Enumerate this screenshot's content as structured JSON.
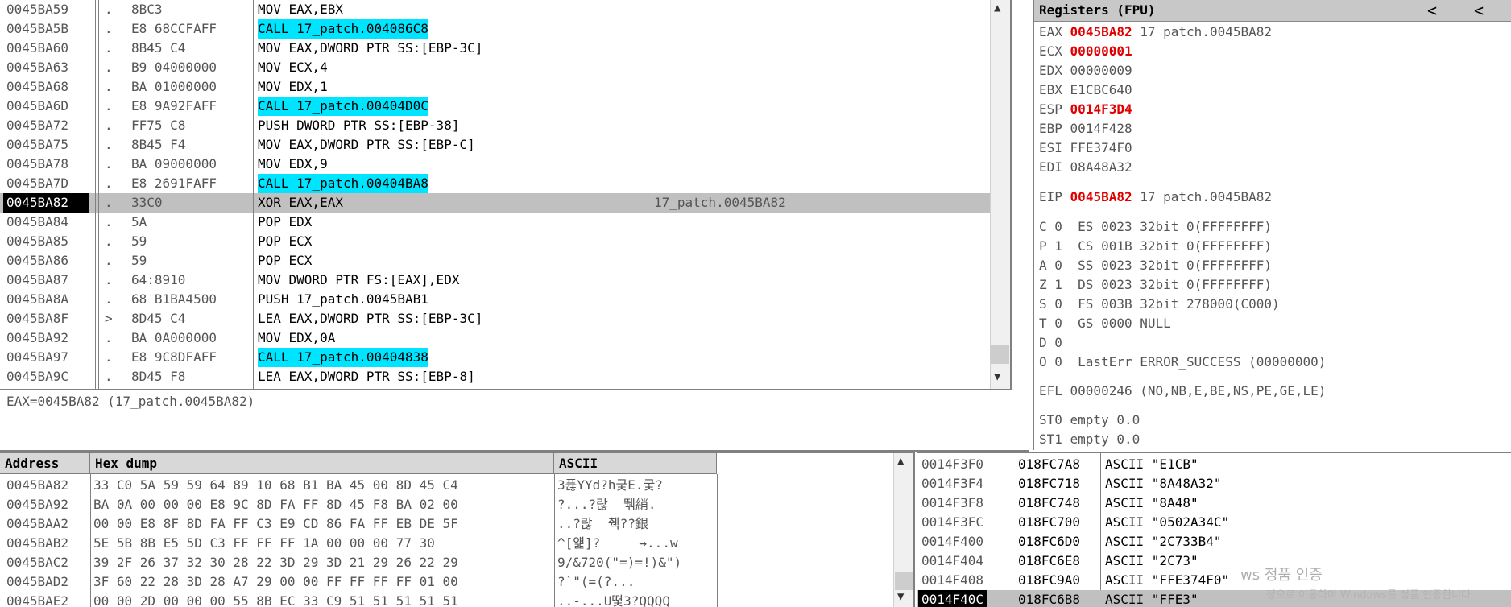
{
  "disasm": {
    "rows": [
      {
        "addr": "0045BA59",
        "mark": ".",
        "hex": "8BC3",
        "asm": "MOV EAX,EBX",
        "call": false,
        "comment": ""
      },
      {
        "addr": "0045BA5B",
        "mark": ".",
        "hex": "E8 68CCFAFF",
        "asm": "CALL 17_patch.004086C8",
        "call": true,
        "comment": ""
      },
      {
        "addr": "0045BA60",
        "mark": ".",
        "hex": "8B45 C4",
        "asm": "MOV EAX,DWORD PTR SS:[EBP-3C]",
        "call": false,
        "comment": ""
      },
      {
        "addr": "0045BA63",
        "mark": ".",
        "hex": "B9 04000000",
        "asm": "MOV ECX,4",
        "call": false,
        "comment": ""
      },
      {
        "addr": "0045BA68",
        "mark": ".",
        "hex": "BA 01000000",
        "asm": "MOV EDX,1",
        "call": false,
        "comment": ""
      },
      {
        "addr": "0045BA6D",
        "mark": ".",
        "hex": "E8 9A92FAFF",
        "asm": "CALL 17_patch.00404D0C",
        "call": true,
        "comment": ""
      },
      {
        "addr": "0045BA72",
        "mark": ".",
        "hex": "FF75 C8",
        "asm": "PUSH DWORD PTR SS:[EBP-38]",
        "call": false,
        "comment": ""
      },
      {
        "addr": "0045BA75",
        "mark": ".",
        "hex": "8B45 F4",
        "asm": "MOV EAX,DWORD PTR SS:[EBP-C]",
        "call": false,
        "comment": ""
      },
      {
        "addr": "0045BA78",
        "mark": ".",
        "hex": "BA 09000000",
        "asm": "MOV EDX,9",
        "call": false,
        "comment": ""
      },
      {
        "addr": "0045BA7D",
        "mark": ".",
        "hex": "E8 2691FAFF",
        "asm": "CALL 17_patch.00404BA8",
        "call": true,
        "comment": ""
      },
      {
        "addr": "0045BA82",
        "mark": ".",
        "hex": "33C0",
        "asm": "XOR EAX,EAX",
        "call": false,
        "comment": "17_patch.0045BA82",
        "selected": true
      },
      {
        "addr": "0045BA84",
        "mark": ".",
        "hex": "5A",
        "asm": "POP EDX",
        "call": false,
        "comment": ""
      },
      {
        "addr": "0045BA85",
        "mark": ".",
        "hex": "59",
        "asm": "POP ECX",
        "call": false,
        "comment": ""
      },
      {
        "addr": "0045BA86",
        "mark": ".",
        "hex": "59",
        "asm": "POP ECX",
        "call": false,
        "comment": ""
      },
      {
        "addr": "0045BA87",
        "mark": ".",
        "hex": "64:8910",
        "asm": "MOV DWORD PTR FS:[EAX],EDX",
        "call": false,
        "comment": ""
      },
      {
        "addr": "0045BA8A",
        "mark": ".",
        "hex": "68 B1BA4500",
        "asm": "PUSH 17_patch.0045BAB1",
        "call": false,
        "comment": ""
      },
      {
        "addr": "0045BA8F",
        "mark": ">",
        "hex": "8D45 C4",
        "asm": "LEA EAX,DWORD PTR SS:[EBP-3C]",
        "call": false,
        "comment": ""
      },
      {
        "addr": "0045BA92",
        "mark": ".",
        "hex": "BA 0A000000",
        "asm": "MOV EDX,0A",
        "call": false,
        "comment": ""
      },
      {
        "addr": "0045BA97",
        "mark": ".",
        "hex": "E8 9C8DFAFF",
        "asm": "CALL 17_patch.00404838",
        "call": true,
        "comment": ""
      },
      {
        "addr": "0045BA9C",
        "mark": ".",
        "hex": "8D45 F8",
        "asm": "LEA EAX,DWORD PTR SS:[EBP-8]",
        "call": false,
        "comment": ""
      }
    ]
  },
  "info": {
    "text": "EAX=0045BA82 (17_patch.0045BA82)"
  },
  "registers": {
    "title": "Registers (FPU)",
    "nav_left": "<",
    "nav_right": "<",
    "general": [
      {
        "name": "EAX",
        "value": "0045BA82",
        "changed": true,
        "comment": "17_patch.0045BA82"
      },
      {
        "name": "ECX",
        "value": "00000001",
        "changed": true,
        "comment": ""
      },
      {
        "name": "EDX",
        "value": "00000009",
        "changed": false,
        "comment": ""
      },
      {
        "name": "EBX",
        "value": "E1CBC640",
        "changed": false,
        "comment": ""
      },
      {
        "name": "ESP",
        "value": "0014F3D4",
        "changed": true,
        "comment": ""
      },
      {
        "name": "EBP",
        "value": "0014F428",
        "changed": false,
        "comment": ""
      },
      {
        "name": "ESI",
        "value": "FFE374F0",
        "changed": false,
        "comment": ""
      },
      {
        "name": "EDI",
        "value": "08A48A32",
        "changed": false,
        "comment": ""
      }
    ],
    "eip": {
      "name": "EIP",
      "value": "0045BA82",
      "changed": true,
      "comment": "17_patch.0045BA82"
    },
    "flags": [
      "C 0  ES 0023 32bit 0(FFFFFFFF)",
      "P 1  CS 001B 32bit 0(FFFFFFFF)",
      "A 0  SS 0023 32bit 0(FFFFFFFF)",
      "Z 1  DS 0023 32bit 0(FFFFFFFF)",
      "S 0  FS 003B 32bit 278000(C000)",
      "T 0  GS 0000 NULL",
      "D 0",
      "O 0  LastErr ERROR_SUCCESS (00000000)"
    ],
    "efl": "EFL 00000246 (NO,NB,E,BE,NS,PE,GE,LE)",
    "fpu": [
      "ST0 empty 0.0",
      "ST1 empty 0.0"
    ]
  },
  "hexdump": {
    "col_address": "Address",
    "col_hex": "Hex dump",
    "col_ascii": "ASCII",
    "rows": [
      {
        "addr": "0045BA82",
        "bytes": "33 C0 5A 59 59 64 89 10 68 B1 BA 45 00 8D 45 C4",
        "ascii": "3퓮YYd?h긏E.궃?"
      },
      {
        "addr": "0045BA92",
        "bytes": "BA 0A 00 00 00 E8 9C 8D FA FF 8D 45 F8 BA 02 00",
        "ascii": "?...?랂  뛖綃."
      },
      {
        "addr": "0045BAA2",
        "bytes": "00 00 E8 8F 8D FA FF C3 E9 CD 86 FA FF EB DE 5F",
        "ascii": "..?랂  췍??銀_"
      },
      {
        "addr": "0045BAB2",
        "bytes": "5E 5B 8B E5 5D C3 FF FF FF 1A 00 00 00 77 30",
        "ascii": "^[얥]?     →...w"
      },
      {
        "addr": "0045BAC2",
        "bytes": "39 2F 26 37 32 30 28 22 3D 29 3D 21 29 26 22 29",
        "ascii": "9/&720(\"=)=!)&\")"
      },
      {
        "addr": "0045BAD2",
        "bytes": "3F 60 22 28 3D 28 A7 29 00 00 FF FF FF FF 01 00",
        "ascii": "?`\"(=(?..."
      },
      {
        "addr": "0045BAE2",
        "bytes": "00 00 2D 00 00 00 55 8B EC 33 C9 51 51 51 51 51",
        "ascii": "..-...U뗯3?QQQQ"
      }
    ]
  },
  "stack": {
    "rows": [
      {
        "addr": "0014F3F0",
        "value": "018FC7A8",
        "comment": "ASCII \"E1CB\""
      },
      {
        "addr": "0014F3F4",
        "value": "018FC718",
        "comment": "ASCII \"8A48A32\""
      },
      {
        "addr": "0014F3F8",
        "value": "018FC748",
        "comment": "ASCII \"8A48\""
      },
      {
        "addr": "0014F3FC",
        "value": "018FC700",
        "comment": "ASCII \"0502A34C\""
      },
      {
        "addr": "0014F400",
        "value": "018FC6D0",
        "comment": "ASCII \"2C733B4\""
      },
      {
        "addr": "0014F404",
        "value": "018FC6E8",
        "comment": "ASCII \"2C73\""
      },
      {
        "addr": "0014F408",
        "value": "018FC9A0",
        "comment": "ASCII \"FFE374F0\""
      },
      {
        "addr": "0014F40C",
        "value": "018FC6B8",
        "comment": "ASCII \"FFE3\"",
        "selected": true
      }
    ]
  },
  "watermark": {
    "line1": "ws 정품 인증",
    "line2": "정으로 이동하여 Windows를 정품 인증합니다."
  },
  "colors": {
    "call_highlight": "#00e5ff",
    "changed_register": "#e00000",
    "selection": "#c0c0c0"
  }
}
